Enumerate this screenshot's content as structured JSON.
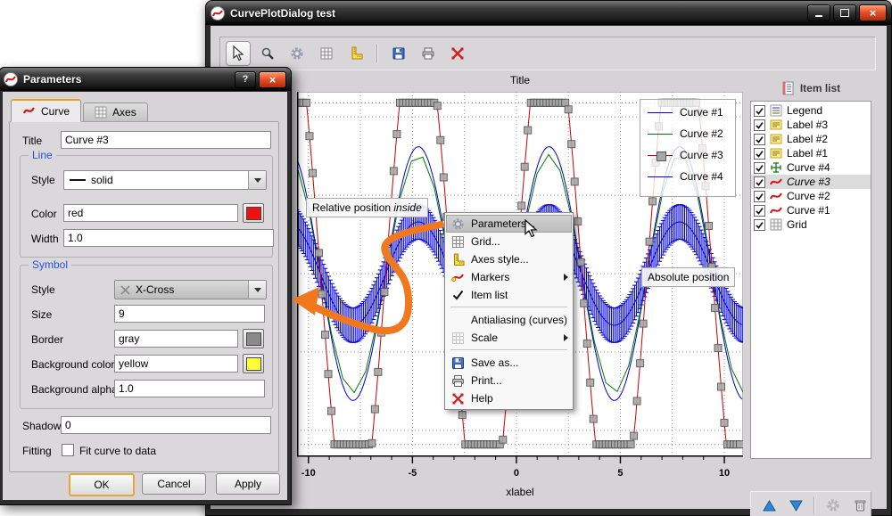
{
  "main_window": {
    "title": "CurvePlotDialog test"
  },
  "toolbar": {
    "icons": [
      "select-arrow",
      "zoom-magnifier",
      "settings-gear",
      "grid",
      "axes-ruler",
      "save",
      "print",
      "markers-cross"
    ]
  },
  "plot": {
    "title": "Title",
    "xlabel": "xlabel"
  },
  "legend": {
    "entries": [
      {
        "label": "Curve #1"
      },
      {
        "label": "Curve #2"
      },
      {
        "label": "Curve #3"
      },
      {
        "label": "Curve #4"
      }
    ]
  },
  "annotations": {
    "relative_text": "Relative position ",
    "relative_italic": "inside",
    "absolute_text": "Absolute position"
  },
  "context_menu": {
    "items": [
      {
        "label": "Parameters...",
        "icon": "gear",
        "highlighted": true
      },
      {
        "label": "Grid...",
        "icon": "grid"
      },
      {
        "label": "Axes style...",
        "icon": "ruler"
      },
      {
        "label": "Markers",
        "icon": "curve",
        "submenu": true
      },
      {
        "label": "Item list",
        "icon": "checkmark",
        "checked": true
      },
      {
        "label": "Antialiasing (curves)"
      },
      {
        "label": "Scale",
        "icon": "grid-light",
        "submenu": true
      },
      {
        "label": "Save as...",
        "icon": "save"
      },
      {
        "label": "Print...",
        "icon": "printer"
      },
      {
        "label": "Help",
        "icon": "red-cross"
      }
    ]
  },
  "item_list": {
    "header": "Item list",
    "items": [
      {
        "label": "Legend",
        "icon": "legend",
        "checked": true
      },
      {
        "label": "Label #3",
        "icon": "label",
        "checked": true
      },
      {
        "label": "Label #2",
        "icon": "label",
        "checked": true
      },
      {
        "label": "Label #1",
        "icon": "label",
        "checked": true
      },
      {
        "label": "Curve #4",
        "icon": "errorbar-curve",
        "checked": true
      },
      {
        "label": "Curve #3",
        "icon": "curve",
        "checked": true,
        "selected": true
      },
      {
        "label": "Curve #2",
        "icon": "curve",
        "checked": true
      },
      {
        "label": "Curve #1",
        "icon": "curve",
        "checked": true
      },
      {
        "label": "Grid",
        "icon": "grid",
        "checked": true
      }
    ],
    "toolbar_icons": [
      "move-up",
      "move-down",
      "settings-gear-disabled",
      "delete-trash"
    ]
  },
  "dialog": {
    "title": "Parameters",
    "help": "?",
    "tabs": [
      {
        "label": "Curve"
      },
      {
        "label": "Axes"
      }
    ],
    "title_field": {
      "label": "Title",
      "value": "Curve #3"
    },
    "line_group": {
      "title": "Line",
      "style_label": "Style",
      "style_value": "solid",
      "color_label": "Color",
      "color_value": "red",
      "color_hex": "#ee1111",
      "width_label": "Width",
      "width_value": "1.0"
    },
    "symbol_group": {
      "title": "Symbol",
      "style_label": "Style",
      "style_value": "X-Cross",
      "size_label": "Size",
      "size_value": "9",
      "border_label": "Border",
      "border_value": "gray",
      "border_hex": "#8a8a8a",
      "bg_label": "Background color",
      "bg_value": "yellow",
      "bg_hex": "#ffff33",
      "alpha_label": "Background alpha",
      "alpha_value": "1.0"
    },
    "shadow_label": "Shadow",
    "shadow_value": "0",
    "fitting_label": "Fitting",
    "fitting_check_label": "Fit curve to data",
    "buttons": {
      "ok": "OK",
      "cancel": "Cancel",
      "apply": "Apply"
    }
  },
  "window_controls": {
    "close": "×"
  },
  "chart_data": {
    "type": "line",
    "title": "Title",
    "xlabel": "xlabel",
    "xlim": [
      -10.55,
      10.9
    ],
    "ylim": [
      -2.32,
      2.32
    ],
    "xticks": [
      -10,
      -5,
      0,
      5,
      10
    ],
    "x_minor_step": 1,
    "grid": {
      "x_step": 2.5,
      "y_step": 1,
      "clip_lines": [
        2.18,
        -2.18
      ],
      "on": true
    },
    "legend_position": "top-right",
    "series": [
      {
        "name": "Curve #1",
        "type": "line",
        "color": "#0000cc",
        "width": 1,
        "function": "a*sin(x)",
        "amplitude": 1.62,
        "sample_step": 0.1,
        "zorder": 1
      },
      {
        "name": "Curve #2",
        "type": "line",
        "color": "#007700",
        "width": 1,
        "function": "a*sin(x)",
        "amplitude": 1.52,
        "sample_step": 0.55,
        "zorder": 2
      },
      {
        "name": "Curve #3",
        "type": "line",
        "color": "#cc0000",
        "width": 1,
        "function": "a*sin(x)",
        "amplitude": 3.5,
        "sample_step": 0.05,
        "clip": 2.18,
        "zorder": 4,
        "symbol": {
          "shape": "square",
          "size": 8,
          "step": 0.15,
          "fill": "#a8a8a8",
          "border": "#555555"
        }
      },
      {
        "name": "Curve #4",
        "type": "errorbar",
        "color": "#0000dd",
        "width": 1,
        "function": "a*sin(x)",
        "amplitude": 0.66,
        "sample_step": 0.1,
        "error": 0.22,
        "error_step": 0.08,
        "zorder": 3
      }
    ]
  }
}
